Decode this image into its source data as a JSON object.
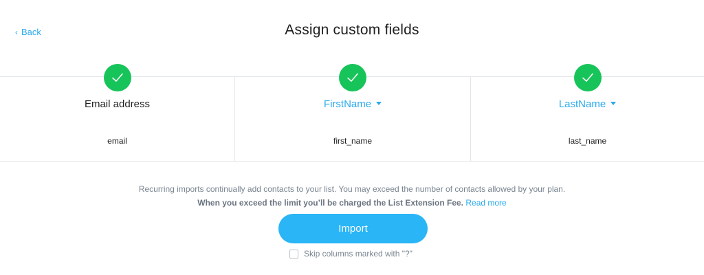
{
  "header": {
    "back_label": "Back",
    "title": "Assign custom fields"
  },
  "columns": [
    {
      "field": "Email address",
      "key": "email",
      "mapped": true,
      "selectable": false
    },
    {
      "field": "FirstName",
      "key": "first_name",
      "mapped": true,
      "selectable": true
    },
    {
      "field": "LastName",
      "key": "last_name",
      "mapped": true,
      "selectable": true
    }
  ],
  "notice": {
    "line1": "Recurring imports continually add contacts to your list. You may exceed the number of contacts allowed by your plan.",
    "line2_strong": "When you exceed the limit you’ll be charged the List Extension Fee.",
    "read_more": "Read more"
  },
  "import_button": "Import",
  "skip": {
    "label": "Skip columns marked with \"?\"",
    "checked": false
  },
  "colors": {
    "accent": "#29a9ec",
    "button": "#29b5f6",
    "success": "#17c45a"
  }
}
